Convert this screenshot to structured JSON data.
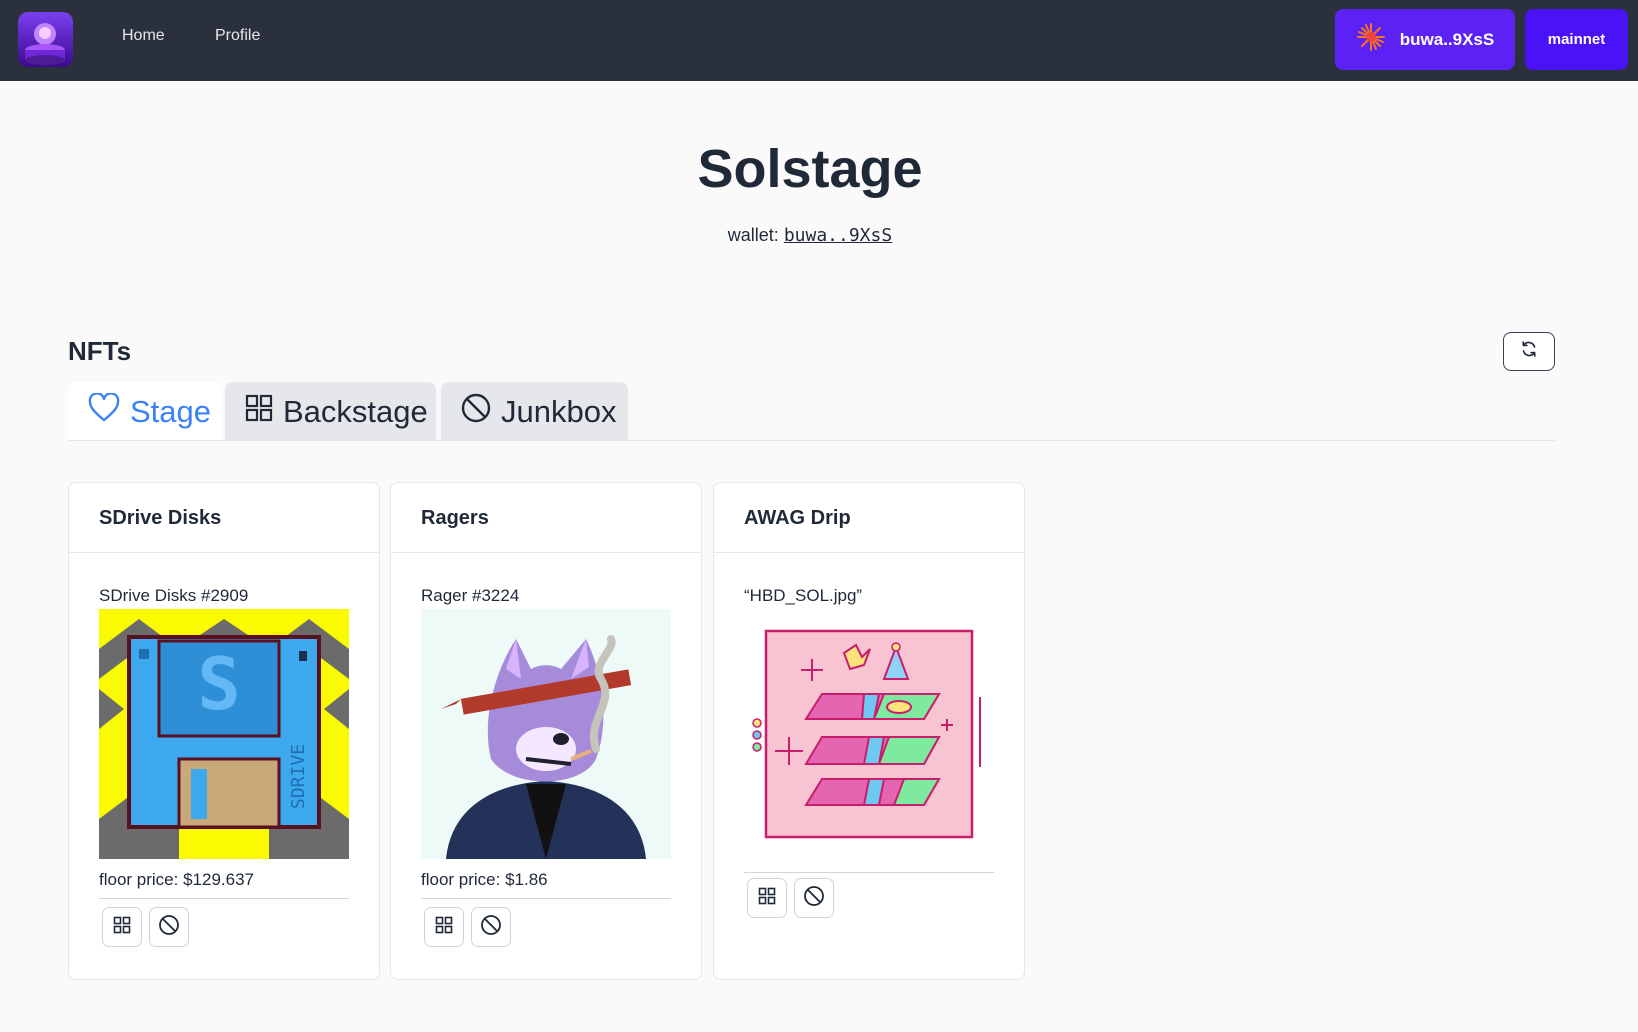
{
  "nav": {
    "home": "Home",
    "profile": "Profile",
    "wallet_button": "buwa..9XsS",
    "network_button": "mainnet"
  },
  "header": {
    "title": "Solstage",
    "wallet_label": "wallet:",
    "wallet_address": "buwa..9XsS"
  },
  "nfts": {
    "heading": "NFTs",
    "tabs": [
      {
        "label": "Stage",
        "icon": "heart-icon",
        "active": true
      },
      {
        "label": "Backstage",
        "icon": "grid-icon",
        "active": false
      },
      {
        "label": "Junkbox",
        "icon": "ban-icon",
        "active": false
      }
    ],
    "cards": [
      {
        "collection": "SDrive Disks",
        "name": "SDrive Disks #2909",
        "floor": "floor price: $129.637"
      },
      {
        "collection": "Ragers",
        "name": "Rager #3224",
        "floor": "floor price: $1.86"
      },
      {
        "collection": "AWAG Drip",
        "name": "“HBD_SOL.jpg”",
        "floor": ""
      }
    ]
  },
  "colors": {
    "navbar": "#2a303c",
    "wallet_button": "#5b21f5",
    "network_button": "#4a12f7",
    "active_tab": "#3b82f6"
  }
}
